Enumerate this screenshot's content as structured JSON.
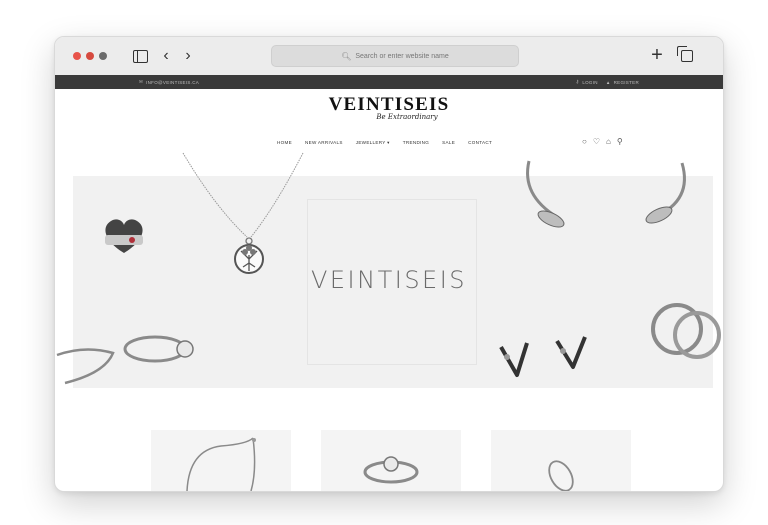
{
  "browser": {
    "address_placeholder": "Search or enter website name",
    "icons": [
      "sidebar-icon",
      "back-icon",
      "forward-icon",
      "new-tab-icon",
      "tabs-overview-icon"
    ]
  },
  "topbar": {
    "email": "INFO@VEINTISEIS.CA",
    "login": "LOGIN",
    "register": "REGISTER"
  },
  "brand": {
    "name": "VEINTISEIS",
    "tagline": "Be Extraordinary"
  },
  "nav": {
    "items": [
      "HOME",
      "NEW ARRIVALS",
      "JEWELLERY",
      "TRENDING",
      "SALE",
      "CONTACT"
    ],
    "dropdown_marker": "▾"
  },
  "header_icons": [
    "account-icon",
    "wishlist-icon",
    "cart-icon",
    "search-icon"
  ],
  "hero": {
    "title": "VEINTISEIS"
  },
  "products": [
    "bracelet",
    "solitaire-ring",
    "thin-ring"
  ],
  "colors": {
    "topbar": "#3a3a3a",
    "hero_bg": "#f1f1f1",
    "traffic_red": "#e8534a"
  }
}
